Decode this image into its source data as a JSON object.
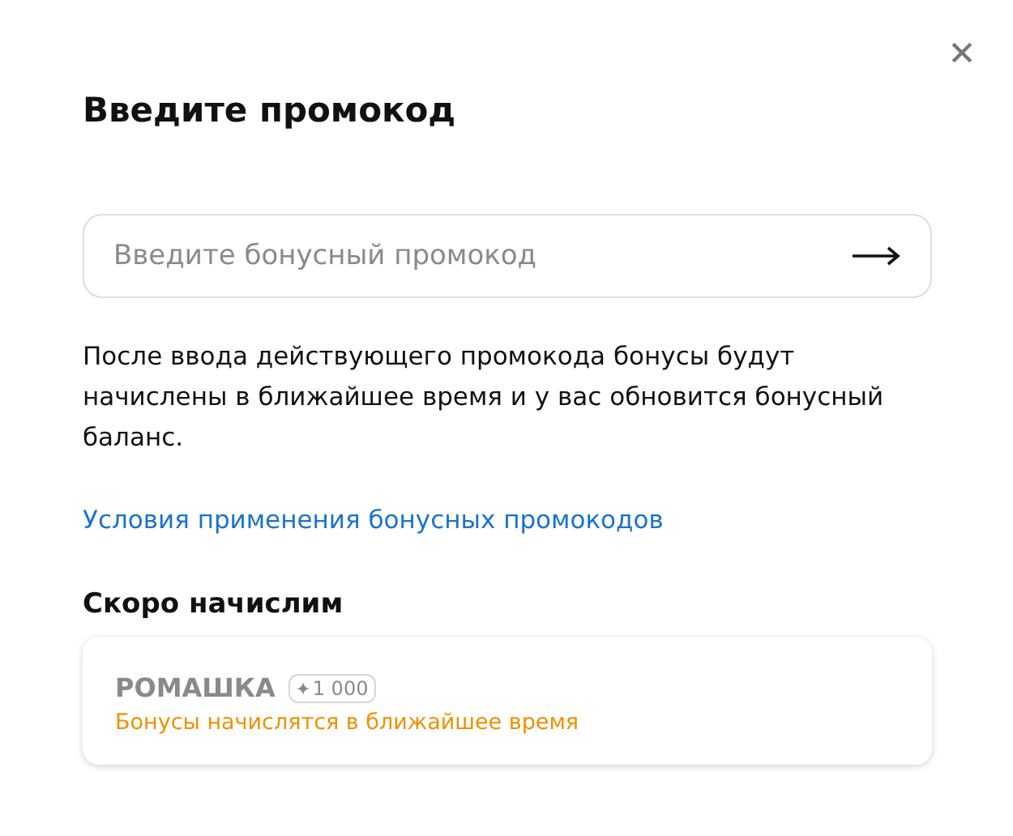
{
  "dialog": {
    "title": "Введите промокод"
  },
  "promo_field": {
    "placeholder": "Введите бонусный промокод"
  },
  "description": "После ввода действующего промокода бонусы будут начислены в ближайшее время и у вас обновится бонусный баланс.",
  "terms_link": "Условия применения бонусных промокодов",
  "pending": {
    "heading": "Скоро начислим",
    "items": [
      {
        "code": "РОМАШКА",
        "badge": "1 000",
        "status": "Бонусы начислятся в ближайшее время"
      }
    ]
  }
}
